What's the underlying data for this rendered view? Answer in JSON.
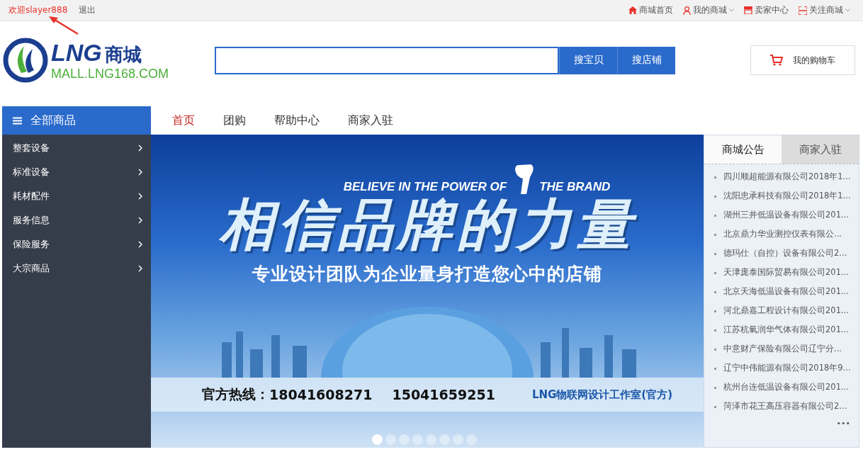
{
  "top_bar": {
    "welcome": "欢迎slayer888",
    "logout": "退出",
    "links": [
      {
        "label": "商城首页",
        "kind": "home",
        "dropdown": false
      },
      {
        "label": "我的商城",
        "kind": "user",
        "dropdown": true
      },
      {
        "label": "卖家中心",
        "kind": "shop",
        "dropdown": false
      },
      {
        "label": "关注商城",
        "kind": "scan",
        "dropdown": true
      }
    ]
  },
  "logo": {
    "brand": "LNG",
    "name": "商城",
    "url": "MALL.LNG168.COM"
  },
  "search": {
    "buttons": [
      "搜宝贝",
      "搜店铺"
    ]
  },
  "cart": {
    "label": "我的购物车"
  },
  "category_header": "全部商品",
  "nav": [
    {
      "label": "首页",
      "selected": true
    },
    {
      "label": "团购",
      "selected": false
    },
    {
      "label": "帮助中心",
      "selected": false
    },
    {
      "label": "商家入驻",
      "selected": false
    }
  ],
  "categories": [
    "整套设备",
    "标准设备",
    "耗材配件",
    "服务信息",
    "保险服务",
    "大宗商品"
  ],
  "banner": {
    "tagline_left": "BELIEVE IN THE POWER OF",
    "tagline_right": "THE BRAND",
    "headline": "相信品牌的力量",
    "subtitle": "专业设计团队为企业量身打造您心中的店铺",
    "hotline_label": "官方热线：",
    "phones": [
      "18041608271",
      "15041659251"
    ],
    "studio": "LNG物联网设计工作室(官方)"
  },
  "carousel": [
    {
      "selected": true
    },
    {
      "selected": false
    },
    {
      "selected": false
    },
    {
      "selected": false
    },
    {
      "selected": false
    },
    {
      "selected": false
    },
    {
      "selected": false
    },
    {
      "selected": false
    }
  ],
  "notice_tabs": [
    {
      "label": "商城公告",
      "selected": true
    },
    {
      "label": "商家入驻",
      "selected": false
    }
  ],
  "notices": [
    "四川顺超能源有限公司2018年1...",
    "沈阳忠承科技有限公司2018年1...",
    "湖州三井低温设备有限公司201...",
    "北京鼎力华业测控仪表有限公...",
    "德玛仕（自控）设备有限公司2...",
    "天津庞泰国际贸易有限公司201...",
    "北京天海低温设备有限公司201...",
    "河北鼎嘉工程设计有限公司201...",
    "江苏杭氧润华气体有限公司201...",
    "中意财产保险有限公司辽宁分...",
    "辽宁中伟能源有限公司2018年9...",
    "杭州台连低温设备有限公司201...",
    "菏泽市花王高压容器有限公司2..."
  ],
  "more": "•••"
}
